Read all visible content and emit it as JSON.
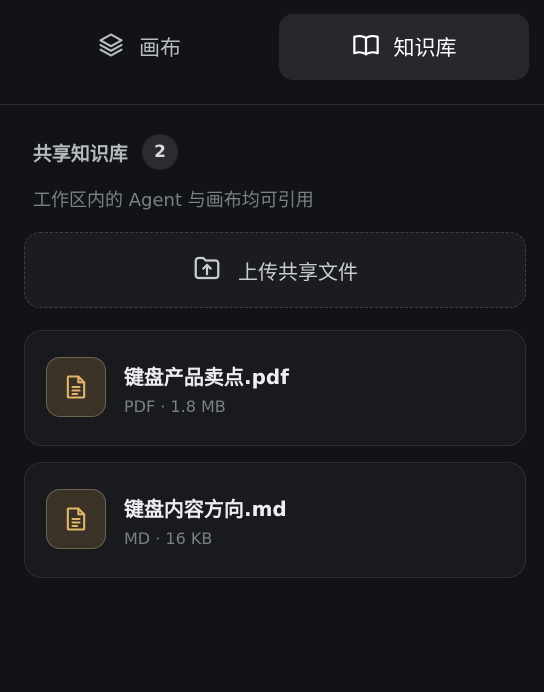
{
  "tabs": [
    {
      "label": "画布",
      "icon": "layers-icon",
      "active": false
    },
    {
      "label": "知识库",
      "icon": "book-open-icon",
      "active": true
    }
  ],
  "section": {
    "title": "共享知识库",
    "count": "2",
    "subtitle": "工作区内的 Agent 与画布均可引用"
  },
  "upload": {
    "label": "上传共享文件",
    "icon": "folder-upload-icon"
  },
  "files": [
    {
      "name": "键盘产品卖点.pdf",
      "meta": "PDF · 1.8 MB",
      "icon": "file-text-icon"
    },
    {
      "name": "键盘内容方向.md",
      "meta": "MD · 16 KB",
      "icon": "file-text-icon"
    }
  ],
  "colors": {
    "background": "#121316",
    "active_tab": "#26282d",
    "file_icon_accent": "#e0b56a"
  }
}
